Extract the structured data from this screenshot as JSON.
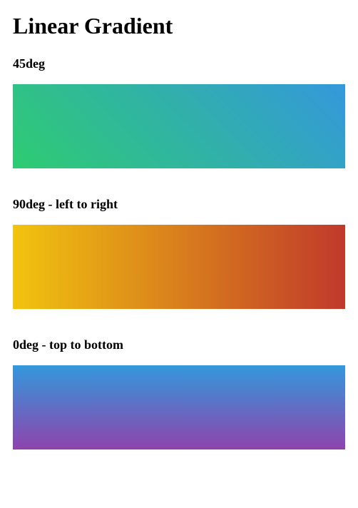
{
  "page": {
    "title": "Linear Gradient"
  },
  "samples": [
    {
      "id": "sample-45deg",
      "heading": "45deg",
      "gradient": "linear-gradient(45deg, #2ecc71, #3498db)"
    },
    {
      "id": "sample-90deg",
      "heading": "90deg - left to right",
      "gradient": "linear-gradient(90deg, #f1c40f, #c0392b)"
    },
    {
      "id": "sample-0deg",
      "heading": "0deg - top to bottom",
      "gradient": "linear-gradient(180deg, #3498db, #8e44ad)"
    }
  ]
}
